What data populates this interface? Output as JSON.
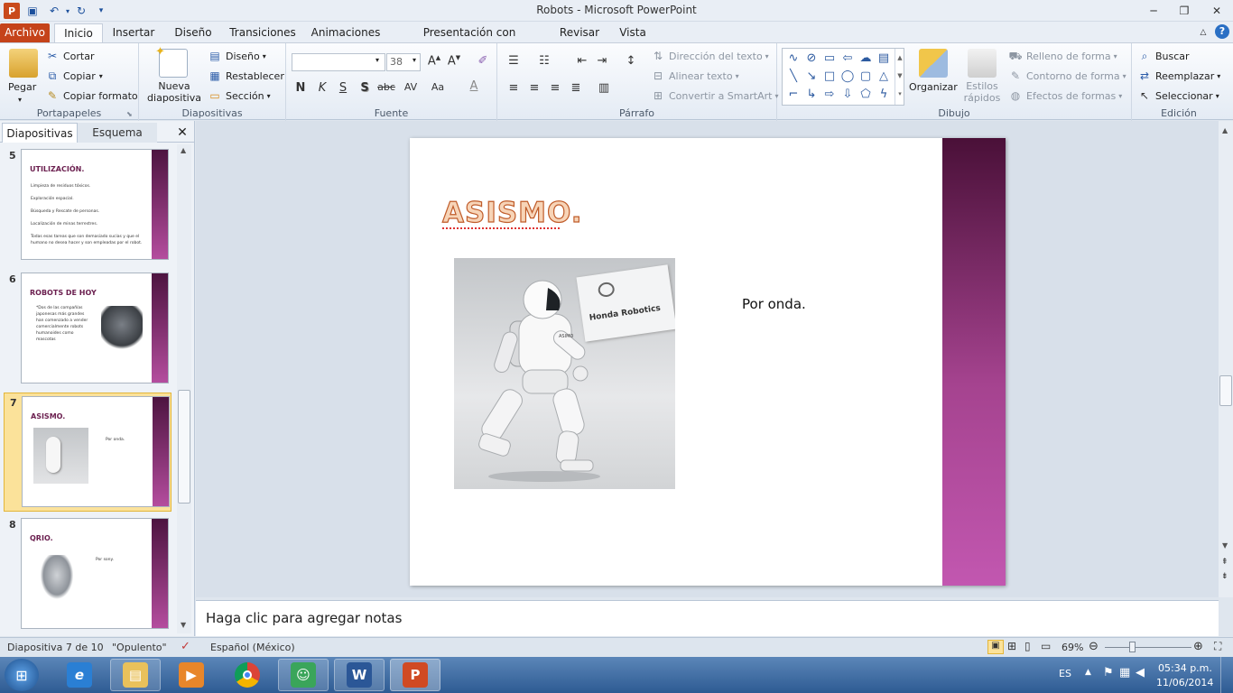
{
  "window": {
    "title": "Robots  -  Microsoft PowerPoint",
    "app_logo_letter": "P"
  },
  "tabs": [
    "Archivo",
    "Inicio",
    "Insertar",
    "Diseño",
    "Transiciones",
    "Animaciones",
    "Presentación con diapositivas",
    "Revisar",
    "Vista"
  ],
  "ribbon": {
    "portapapeles": {
      "label": "Portapapeles",
      "paste": "Pegar",
      "cut": "Cortar",
      "copy": "Copiar",
      "format_painter": "Copiar formato"
    },
    "diapositivas": {
      "label": "Diapositivas",
      "new_slide": "Nueva diapositiva",
      "layout": "Diseño",
      "reset": "Restablecer",
      "section": "Sección"
    },
    "fuente": {
      "label": "Fuente",
      "font_name": "",
      "font_size": "38"
    },
    "parrafo": {
      "label": "Párrafo",
      "text_direction": "Dirección del texto",
      "align_text": "Alinear texto",
      "smartart": "Convertir a SmartArt"
    },
    "dibujo": {
      "label": "Dibujo",
      "arrange": "Organizar",
      "quick_styles": "Estilos rápidos",
      "shape_fill": "Relleno de forma",
      "shape_outline": "Contorno de forma",
      "shape_effects": "Efectos de formas"
    },
    "edicion": {
      "label": "Edición",
      "find": "Buscar",
      "replace": "Reemplazar",
      "select": "Seleccionar"
    }
  },
  "left_panel": {
    "tab_slides": "Diapositivas",
    "tab_outline": "Esquema",
    "close": "✕",
    "thumbnails": [
      {
        "num": "5",
        "title": "UTILIZACIÓN.",
        "lines": [
          "Limpieza de residuos tóxicos.",
          "Exploración espacial.",
          "Búsqueda y Rescate de personas.",
          "Localización de minas terrestres.",
          "Todas esas tareas que son demasiado sucias y que el humano no desea hacer y son empleadas por el robot."
        ]
      },
      {
        "num": "6",
        "title": "ROBOTS DE HOY",
        "lines": [
          "*Dos de las compañías japonesas más grandes han comenzado a vender comercialmente robots humanoides como mascotas"
        ]
      },
      {
        "num": "7",
        "title": "ASISMO.",
        "lines": [
          "Por onda."
        ]
      },
      {
        "num": "8",
        "title": "QRIO.",
        "lines": [
          "Por sony."
        ]
      }
    ]
  },
  "slide": {
    "title": "ASISMO.",
    "body": "Por onda.",
    "sign_text": "Honda Robotics",
    "robot_chest_text": "ASIMO"
  },
  "notes": {
    "placeholder": "Haga clic para agregar notas"
  },
  "status": {
    "slide_counter": "Diapositiva 7 de 10",
    "theme": "\"Opulento\"",
    "language": "Español (México)",
    "zoom": "69%"
  },
  "taskbar": {
    "lang": "ES",
    "time": "05:34 p.m.",
    "date": "11/06/2014"
  },
  "colors": {
    "accent_orange": "#c5431a",
    "slide_bar_dark": "#4a1038",
    "slide_bar_light": "#c257b0",
    "title_fill": "#f7d4b7"
  }
}
